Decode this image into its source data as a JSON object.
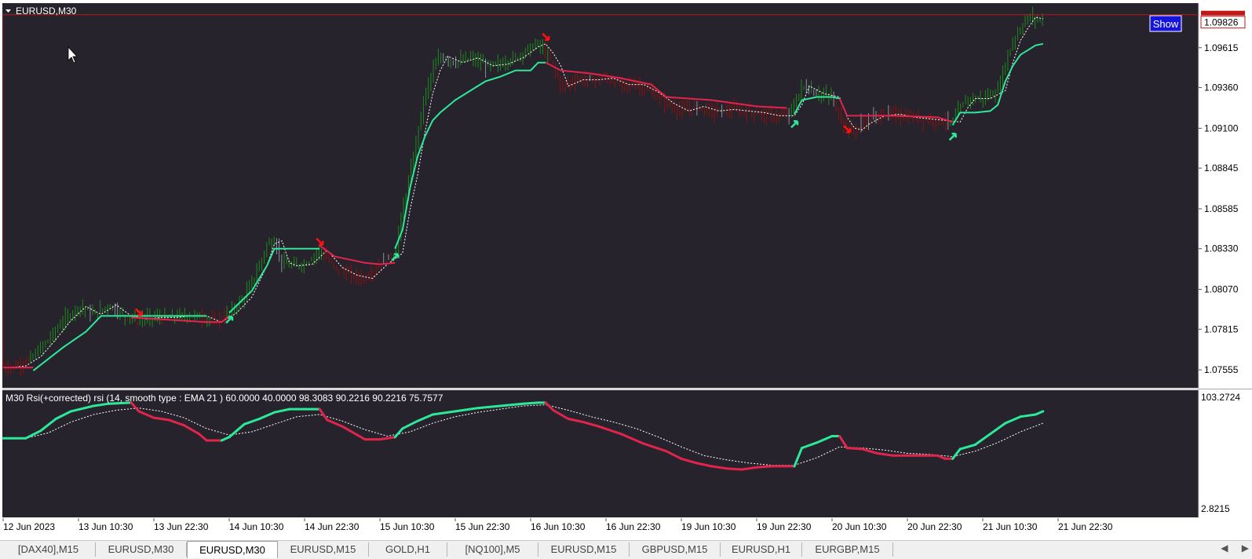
{
  "window": {
    "symbol_title": "EURUSD,M30",
    "show_button": "Show"
  },
  "colors": {
    "background": "#27232c",
    "bull": "#2ee89a",
    "bear": "#e0244c",
    "candle_up": "#1a8a1a",
    "candle_down": "#8a1010",
    "candle_neutral": "#8a8f9e",
    "price_line": "#c01818",
    "signal_line": "#ffffff"
  },
  "indicator_label": "M30 Rsi(+corrected) rsi (14, smooth type : EMA  21 ) 60.0000 40.0000 98.3083 90.2216 90.2216 75.7577",
  "tabs": [
    "[DAX40],M15",
    "EURUSD,M30",
    "EURUSD,M30",
    "EURUSD,M15",
    "GOLD,H1",
    "[NQ100],M5",
    "EURUSD,M15",
    "GBPUSD,M15",
    "EURUSD,H1",
    "EURGBP,M15"
  ],
  "active_tab": 2,
  "tab_scroll": {
    "left": "◀",
    "right": "▶"
  },
  "chart_data": [
    {
      "type": "line",
      "symbol": "EURUSD",
      "timeframe": "M30",
      "x_ticks": [
        "12 Jun 2023",
        "13 Jun 10:30",
        "13 Jun 22:30",
        "14 Jun 10:30",
        "14 Jun 22:30",
        "15 Jun 10:30",
        "15 Jun 22:30",
        "16 Jun 10:30",
        "16 Jun 22:30",
        "19 Jun 10:30",
        "19 Jun 22:30",
        "20 Jun 10:30",
        "20 Jun 22:30",
        "21 Jun 10:30",
        "21 Jun 22:30"
      ],
      "y_ticks": [
        "1.09615",
        "1.09360",
        "1.09100",
        "1.08845",
        "1.08585",
        "1.08330",
        "1.08070",
        "1.07815",
        "1.07555"
      ],
      "ylim": [
        1.0744,
        1.099
      ],
      "current_price": "1.09826",
      "current_price_value": 1.09826,
      "price_path": [
        [
          0,
          1.0757
        ],
        [
          2,
          1.0758
        ],
        [
          4,
          1.0764
        ],
        [
          6,
          1.0775
        ],
        [
          8,
          1.0787
        ],
        [
          10,
          1.0796
        ],
        [
          12,
          1.0791
        ],
        [
          14,
          1.0797
        ],
        [
          16,
          1.079
        ],
        [
          18,
          1.0788
        ],
        [
          20,
          1.0789
        ],
        [
          22,
          1.0789
        ],
        [
          24,
          1.079
        ],
        [
          26,
          1.079
        ],
        [
          28,
          1.0786
        ],
        [
          30,
          1.0792
        ],
        [
          32,
          1.0802
        ],
        [
          34,
          1.0822
        ],
        [
          35,
          1.0836
        ],
        [
          36,
          1.0838
        ],
        [
          37,
          1.0824
        ],
        [
          38,
          1.0822
        ],
        [
          40,
          1.0823
        ],
        [
          42,
          1.0832
        ],
        [
          44,
          1.0821
        ],
        [
          46,
          1.0816
        ],
        [
          48,
          1.0814
        ],
        [
          50,
          1.0823
        ],
        [
          52,
          1.083
        ],
        [
          53,
          1.0858
        ],
        [
          54,
          1.088
        ],
        [
          55,
          1.0908
        ],
        [
          56,
          1.0932
        ],
        [
          57,
          1.0947
        ],
        [
          58,
          1.0956
        ],
        [
          60,
          1.0952
        ],
        [
          62,
          1.0955
        ],
        [
          64,
          1.095
        ],
        [
          66,
          1.0951
        ],
        [
          68,
          1.0955
        ],
        [
          70,
          1.0962
        ],
        [
          71,
          1.0964
        ],
        [
          72,
          1.0958
        ],
        [
          73,
          1.095
        ],
        [
          74,
          1.0937
        ],
        [
          76,
          1.0941
        ],
        [
          78,
          1.0941
        ],
        [
          80,
          1.0942
        ],
        [
          82,
          1.0938
        ],
        [
          84,
          1.0938
        ],
        [
          86,
          1.0933
        ],
        [
          88,
          1.0926
        ],
        [
          90,
          1.0921
        ],
        [
          92,
          1.0924
        ],
        [
          94,
          1.0921
        ],
        [
          96,
          1.0922
        ],
        [
          98,
          1.0921
        ],
        [
          100,
          1.092
        ],
        [
          102,
          1.0918
        ],
        [
          104,
          1.0918
        ],
        [
          105,
          1.0925
        ],
        [
          106,
          1.0937
        ],
        [
          108,
          1.0932
        ],
        [
          110,
          1.093
        ],
        [
          111,
          1.0917
        ],
        [
          112,
          1.091
        ],
        [
          113,
          1.0909
        ],
        [
          114,
          1.0913
        ],
        [
          116,
          1.0918
        ],
        [
          118,
          1.0919
        ],
        [
          120,
          1.0917
        ],
        [
          122,
          1.0916
        ],
        [
          124,
          1.0915
        ],
        [
          126,
          1.0914
        ],
        [
          127,
          1.0923
        ],
        [
          128,
          1.0929
        ],
        [
          130,
          1.0929
        ],
        [
          132,
          1.0934
        ],
        [
          133,
          1.0952
        ],
        [
          134,
          1.0966
        ],
        [
          135,
          1.0974
        ],
        [
          136,
          1.0981
        ],
        [
          137,
          1.098
        ],
        [
          138,
          1.0979
        ]
      ],
      "trend_up_segments": [
        [
          [
            4,
            1.0755
          ],
          [
            8,
            1.077
          ],
          [
            11,
            1.078
          ],
          [
            13,
            1.079
          ],
          [
            27,
            1.079
          ]
        ],
        [
          [
            30,
            1.0792
          ],
          [
            33,
            1.0806
          ],
          [
            35,
            1.0822
          ],
          [
            36,
            1.0833
          ],
          [
            42,
            1.0833
          ]
        ],
        [
          [
            52,
            1.0833
          ],
          [
            53,
            1.0845
          ],
          [
            54,
            1.0872
          ],
          [
            55,
            1.0892
          ],
          [
            56,
            1.0905
          ],
          [
            57,
            1.0915
          ],
          [
            58,
            1.092
          ],
          [
            60,
            1.0928
          ],
          [
            62,
            1.0934
          ],
          [
            64,
            1.094
          ],
          [
            66,
            1.0943
          ],
          [
            68,
            1.0947
          ],
          [
            70,
            1.0947
          ],
          [
            71,
            1.0952
          ],
          [
            72,
            1.0952
          ]
        ],
        [
          [
            105,
            1.0919
          ],
          [
            106,
            1.0928
          ],
          [
            108,
            1.093
          ],
          [
            110,
            1.093
          ],
          [
            111,
            1.0929
          ]
        ],
        [
          [
            126,
            1.0912
          ],
          [
            127,
            1.092
          ],
          [
            129,
            1.092
          ],
          [
            131,
            1.0921
          ],
          [
            132,
            1.0925
          ],
          [
            133,
            1.094
          ],
          [
            134,
            1.095
          ],
          [
            135,
            1.0957
          ],
          [
            136,
            1.096
          ],
          [
            137,
            1.0963
          ],
          [
            138,
            1.0964
          ]
        ]
      ],
      "trend_down_segments": [
        [
          [
            0,
            1.0757
          ],
          [
            4,
            1.0757
          ]
        ],
        [
          [
            17,
            1.0789
          ],
          [
            27,
            1.0786
          ],
          [
            28,
            1.0786
          ],
          [
            29,
            1.0786
          ],
          [
            30,
            1.079
          ]
        ],
        [
          [
            42,
            1.0835
          ],
          [
            44,
            1.0828
          ],
          [
            46,
            1.0826
          ],
          [
            48,
            1.0824
          ],
          [
            50,
            1.0823
          ],
          [
            52,
            1.0824
          ]
        ],
        [
          [
            72,
            1.0952
          ],
          [
            74,
            1.0947
          ],
          [
            76,
            1.0946
          ],
          [
            78,
            1.0945
          ],
          [
            82,
            1.0942
          ],
          [
            84,
            1.094
          ],
          [
            86,
            1.0938
          ],
          [
            88,
            1.093
          ],
          [
            94,
            1.0928
          ],
          [
            100,
            1.0924
          ],
          [
            104,
            1.0923
          ]
        ],
        [
          [
            111,
            1.0929
          ],
          [
            112,
            1.0918
          ],
          [
            118,
            1.0918
          ],
          [
            124,
            1.0917
          ],
          [
            126,
            1.0914
          ]
        ]
      ],
      "up_arrows": [
        [
          30,
          1.0788
        ],
        [
          105,
          1.0913
        ],
        [
          126,
          1.0905
        ],
        [
          52,
          1.0828
        ]
      ],
      "down_arrows": [
        [
          18,
          1.0792
        ],
        [
          42,
          1.0837
        ],
        [
          72,
          1.0968
        ],
        [
          112,
          1.0909
        ]
      ]
    },
    {
      "type": "line",
      "title": "M30 Rsi(+corrected) rsi (14, smooth type : EMA  21 ) 60.0000 40.0000 98.3083 90.2216 90.2216 75.7577",
      "y_ticks": [
        "103.2724",
        "2.8215"
      ],
      "ylim": [
        2.8215,
        103.2724
      ],
      "rsi": [
        [
          0,
          66
        ],
        [
          3,
          66
        ],
        [
          5,
          73
        ],
        [
          7,
          84
        ],
        [
          9,
          91
        ],
        [
          12,
          96
        ],
        [
          14,
          98
        ],
        [
          17,
          99
        ],
        [
          18,
          91
        ],
        [
          20,
          85
        ],
        [
          22,
          83
        ],
        [
          24,
          78
        ],
        [
          26,
          70
        ],
        [
          27,
          64
        ],
        [
          28,
          64
        ],
        [
          29,
          64
        ],
        [
          30,
          67
        ],
        [
          32,
          79
        ],
        [
          34,
          84
        ],
        [
          36,
          90
        ],
        [
          38,
          93
        ],
        [
          40,
          93
        ],
        [
          41,
          93
        ],
        [
          42,
          93
        ],
        [
          43,
          83
        ],
        [
          45,
          77
        ],
        [
          47,
          69
        ],
        [
          48,
          65
        ],
        [
          50,
          65
        ],
        [
          52,
          67
        ],
        [
          53,
          75
        ],
        [
          55,
          82
        ],
        [
          57,
          88
        ],
        [
          60,
          91
        ],
        [
          63,
          94
        ],
        [
          66,
          96
        ],
        [
          69,
          98
        ],
        [
          71,
          99
        ],
        [
          72,
          99
        ],
        [
          73,
          92
        ],
        [
          75,
          84
        ],
        [
          77,
          81
        ],
        [
          79,
          77
        ],
        [
          82,
          70
        ],
        [
          85,
          61
        ],
        [
          88,
          54
        ],
        [
          90,
          47
        ],
        [
          92,
          43
        ],
        [
          94,
          40
        ],
        [
          96,
          38
        ],
        [
          98,
          37
        ],
        [
          100,
          39
        ],
        [
          102,
          40
        ],
        [
          104,
          40
        ],
        [
          105,
          40
        ],
        [
          106,
          57
        ],
        [
          108,
          62
        ],
        [
          110,
          68
        ],
        [
          111,
          68
        ],
        [
          112,
          57
        ],
        [
          114,
          56
        ],
        [
          116,
          52
        ],
        [
          118,
          50
        ],
        [
          120,
          50
        ],
        [
          122,
          50
        ],
        [
          124,
          50
        ],
        [
          125,
          47
        ],
        [
          126,
          47
        ],
        [
          127,
          56
        ],
        [
          129,
          60
        ],
        [
          131,
          70
        ],
        [
          133,
          80
        ],
        [
          135,
          86
        ],
        [
          137,
          88
        ],
        [
          138,
          91
        ]
      ],
      "rsi_up_ranges": [
        [
          0,
          17
        ],
        [
          29,
          42
        ],
        [
          52,
          72
        ],
        [
          105,
          111
        ],
        [
          126,
          138
        ]
      ],
      "rsi_signal": [
        [
          0,
          66
        ],
        [
          3,
          66
        ],
        [
          6,
          71
        ],
        [
          9,
          81
        ],
        [
          12,
          88
        ],
        [
          15,
          92
        ],
        [
          18,
          94
        ],
        [
          21,
          91
        ],
        [
          24,
          85
        ],
        [
          27,
          75
        ],
        [
          30,
          69
        ],
        [
          33,
          72
        ],
        [
          36,
          79
        ],
        [
          39,
          86
        ],
        [
          42,
          88
        ],
        [
          45,
          82
        ],
        [
          48,
          74
        ],
        [
          51,
          68
        ],
        [
          54,
          72
        ],
        [
          57,
          80
        ],
        [
          60,
          86
        ],
        [
          63,
          90
        ],
        [
          66,
          93
        ],
        [
          69,
          96
        ],
        [
          72,
          97
        ],
        [
          75,
          92
        ],
        [
          78,
          86
        ],
        [
          81,
          81
        ],
        [
          84,
          75
        ],
        [
          87,
          67
        ],
        [
          90,
          58
        ],
        [
          93,
          50
        ],
        [
          96,
          46
        ],
        [
          99,
          43
        ],
        [
          102,
          41
        ],
        [
          105,
          41
        ],
        [
          108,
          48
        ],
        [
          111,
          58
        ],
        [
          114,
          57
        ],
        [
          117,
          55
        ],
        [
          120,
          52
        ],
        [
          123,
          51
        ],
        [
          126,
          49
        ],
        [
          129,
          54
        ],
        [
          132,
          62
        ],
        [
          135,
          72
        ],
        [
          138,
          80
        ]
      ]
    }
  ]
}
